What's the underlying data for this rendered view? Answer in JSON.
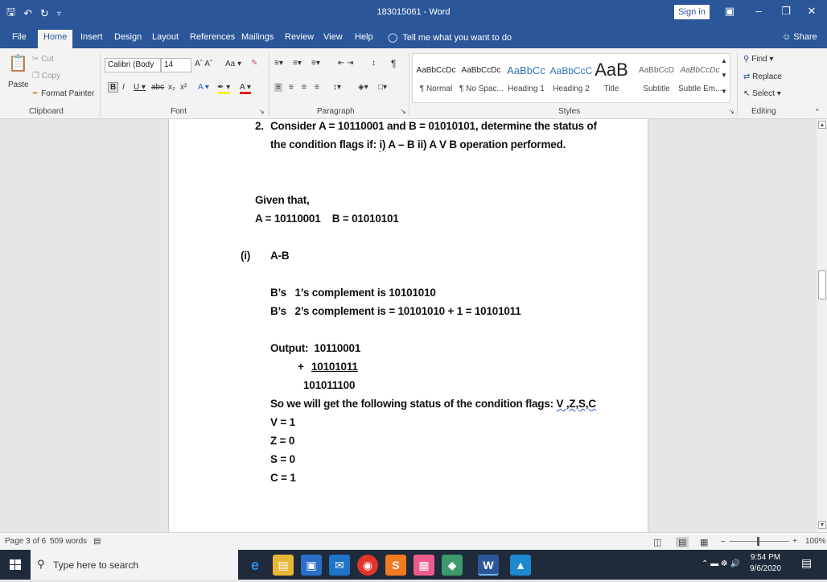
{
  "window": {
    "title": "183015061 - Word",
    "sign_in": "Sign in",
    "restore_icon": "ribbon-display-icon",
    "minimize": "–",
    "maximize": "❐",
    "close": "✕"
  },
  "menu": {
    "tabs": [
      "File",
      "Home",
      "Insert",
      "Design",
      "Layout",
      "References",
      "Mailings",
      "Review",
      "View",
      "Help"
    ],
    "active_tab": "Home",
    "tell_me": "Tell me what you want to do",
    "share": "Share"
  },
  "ribbon": {
    "clipboard": {
      "paste": "Paste",
      "cut": "Cut",
      "copy": "Copy",
      "format_painter": "Format Painter",
      "label": "Clipboard"
    },
    "font": {
      "family": "Calibri (Body",
      "size": "14",
      "label": "Font"
    },
    "paragraph": {
      "label": "Paragraph"
    },
    "styles": {
      "label": "Styles",
      "items": [
        {
          "preview": "AaBbCcDc",
          "name": "¶ Normal"
        },
        {
          "preview": "AaBbCcDc",
          "name": "¶ No Spac..."
        },
        {
          "preview": "AaBbCc",
          "name": "Heading 1"
        },
        {
          "preview": "AaBbCcC",
          "name": "Heading 2"
        },
        {
          "preview": "AaB",
          "name": "Title"
        },
        {
          "preview": "AaBbCcD",
          "name": "Subtitle"
        },
        {
          "preview": "AaBbCcDc",
          "name": "Subtle Em..."
        }
      ]
    },
    "editing": {
      "find": "Find",
      "replace": "Replace",
      "select": "Select",
      "label": "Editing"
    }
  },
  "document": {
    "q_num": "2.",
    "q_line1": "Consider A = 10110001 and B = 01010101, determine the status of",
    "q_line2_a": "the condition flags if: ",
    "q_line2_i": "i)",
    "q_line2_b": " A – B ii) A V B operation performed.",
    "given": "Given that,",
    "given_values": "A = 10110001    B = 01010101",
    "part_num": "(i)",
    "part_title": "A-B",
    "ones_comp": "B’s   1’s complement is 10101010",
    "twos_comp": "B’s   2’s complement is = 10101010 + 1 = 10101011",
    "output_label": "Output:  10110001",
    "plus_sign": "+",
    "addend": "10101011",
    "sum": "101011100",
    "status_line_a": "So we will get the following status of the condition flags: ",
    "status_line_b": "V ,Z,S,C",
    "flags": [
      "V = 1",
      "Z = 0",
      "S = 0",
      "C = 1"
    ]
  },
  "statusbar": {
    "page": "Page 3 of 6",
    "words": "509 words",
    "zoom": "100%",
    "zoom_minus": "–",
    "zoom_plus": "+"
  },
  "taskbar": {
    "search_placeholder": "Type here to search",
    "time": "9:54 PM",
    "date": "9/6/2020"
  }
}
